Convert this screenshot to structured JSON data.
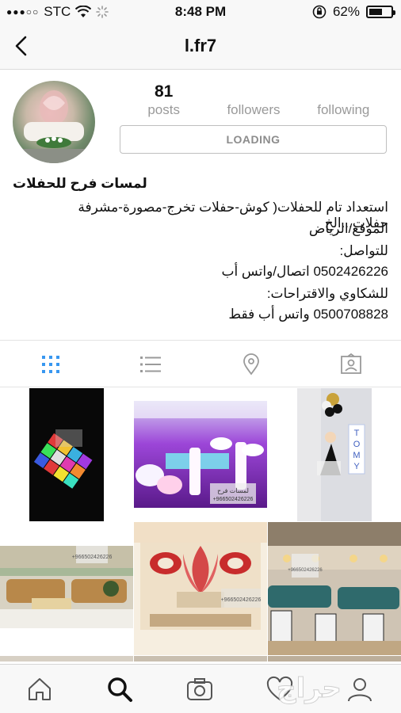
{
  "status_bar": {
    "carrier": "STC",
    "signal_dots": "●●●○○",
    "time": "8:48 PM",
    "battery": "62%",
    "battery_level": 0.62
  },
  "nav": {
    "title": "l.fr7"
  },
  "profile": {
    "posts_count": "81",
    "posts_label": "posts",
    "followers_count": "",
    "followers_label": "followers",
    "following_count": "",
    "following_label": "following",
    "action_button": "LOADING"
  },
  "bio": {
    "name": "لمسات فرح للحفلات",
    "lines": [
      "استعداد تام للحفلات( كوش-حفلات تخرج-مصورة-مشرفة حفلات...الخ",
      "الموقع/الرياض",
      "للتواصل:",
      "0502426226 اتصال/واتس أب",
      "للشكاوي والاقتراحات:",
      "0500708828 واتس أب فقط"
    ]
  },
  "tabs": [
    {
      "icon": "grid-icon",
      "active": true
    },
    {
      "icon": "list-icon",
      "active": false
    },
    {
      "icon": "location-pin-icon",
      "active": false
    },
    {
      "icon": "tagged-photos-icon",
      "active": false
    }
  ],
  "grid_watermarks": {
    "brand": "لمسات فرح",
    "phone": "+966502426226"
  },
  "bottom_bar": {
    "items": [
      "home-icon",
      "search-icon",
      "camera-icon",
      "heart-icon",
      "profile-icon"
    ],
    "watermark": "حراج"
  },
  "colors": {
    "accent": "#3897f0",
    "muted": "#9a9a9a",
    "bar_bg": "#f8f8f8"
  }
}
